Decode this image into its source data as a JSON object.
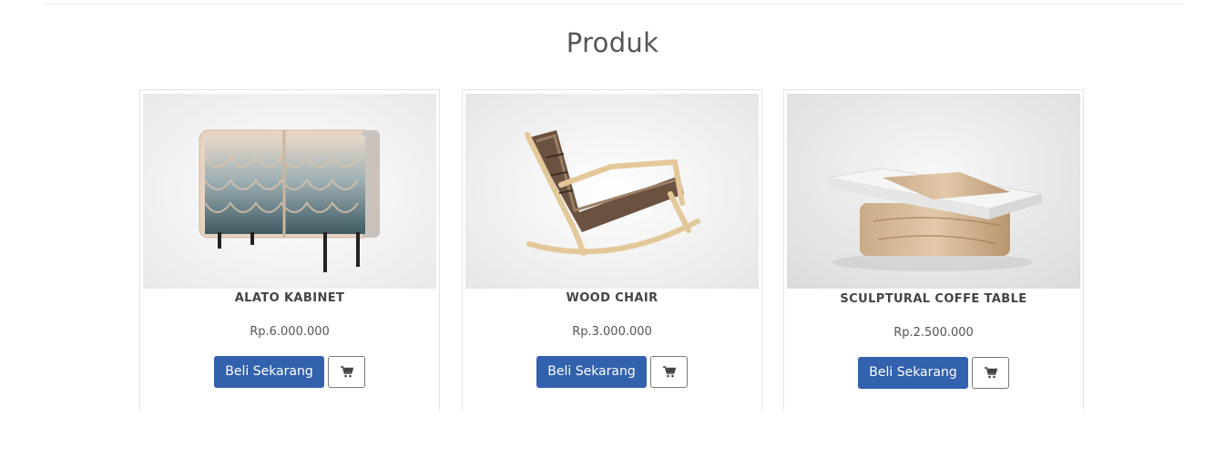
{
  "section": {
    "title": "Produk"
  },
  "products": [
    {
      "name": "ALATO KABINET",
      "price": "Rp.6.000.000",
      "buy_label": "Beli Sekarang",
      "image_icon": "cabinet-image"
    },
    {
      "name": "WOOD CHAIR",
      "price": "Rp.3.000.000",
      "buy_label": "Beli Sekarang",
      "image_icon": "rocking-chair-image"
    },
    {
      "name": "SCULPTURAL COFFE TABLE",
      "price": "Rp.2.500.000",
      "buy_label": "Beli Sekarang",
      "image_icon": "coffee-table-image"
    }
  ],
  "colors": {
    "accent": "#3261ad"
  }
}
